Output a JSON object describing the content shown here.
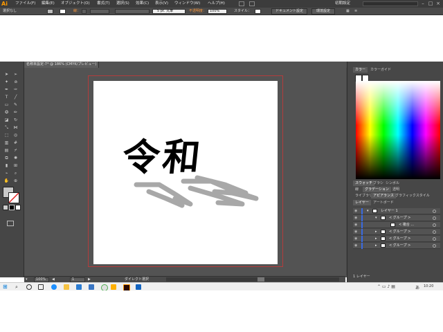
{
  "app": {
    "logo": "Ai",
    "search_placeholder": "",
    "workspace": "初期設定"
  },
  "menu": [
    "ファイル(F)",
    "編集(E)",
    "オブジェクト(O)",
    "書式(T)",
    "選択(S)",
    "効果(C)",
    "表示(V)",
    "ウィンドウ(W)",
    "ヘルプ(H)"
  ],
  "control": {
    "selection": "選択なし",
    "stroke_label": "線：",
    "brush": "5 pt. 丸筆",
    "opacity_label": "不透明度：",
    "opacity_value": "100%",
    "style_label": "スタイル：",
    "doc_settings_button": "ドキュメント設定",
    "prefs_button": "環境設定"
  },
  "document": {
    "tab_title": "名称未設定-7* @ 186% (CMYK/プレビュー)",
    "artwork_text": "令和"
  },
  "status": {
    "zoom": "100%",
    "page": "1",
    "tool": "ダイレクト選択"
  },
  "panels": {
    "top_tabs": [
      "カラー",
      "カラーガイド"
    ],
    "mid_tabs_1": [
      "スウォッチ",
      "ブラシ",
      "シンボル"
    ],
    "mid_tabs_2": [
      "線",
      "グラデーション",
      "透明"
    ],
    "mid_tabs_3": [
      "ライブラリ",
      "アピアランス",
      "グラフィックスタイル"
    ],
    "layer_tabs": [
      "レイヤー",
      "アートボード"
    ],
    "layers": [
      {
        "label": "レイヤー 1",
        "indent": 0
      },
      {
        "label": "< グループ >",
        "indent": 1
      },
      {
        "label": "< 複合 ...",
        "indent": 2
      },
      {
        "label": "< グループ >",
        "indent": 1
      },
      {
        "label": "< グループ >",
        "indent": 1
      },
      {
        "label": "< グループ >",
        "indent": 1
      }
    ],
    "layer_count": "1 レイヤー"
  },
  "taskbar": {
    "time": "10:20",
    "ime": "あ"
  },
  "colors": {
    "accent_blue": "#3a6ae0",
    "artboard_border": "#b43c3c",
    "ui_dark": "#535353"
  }
}
